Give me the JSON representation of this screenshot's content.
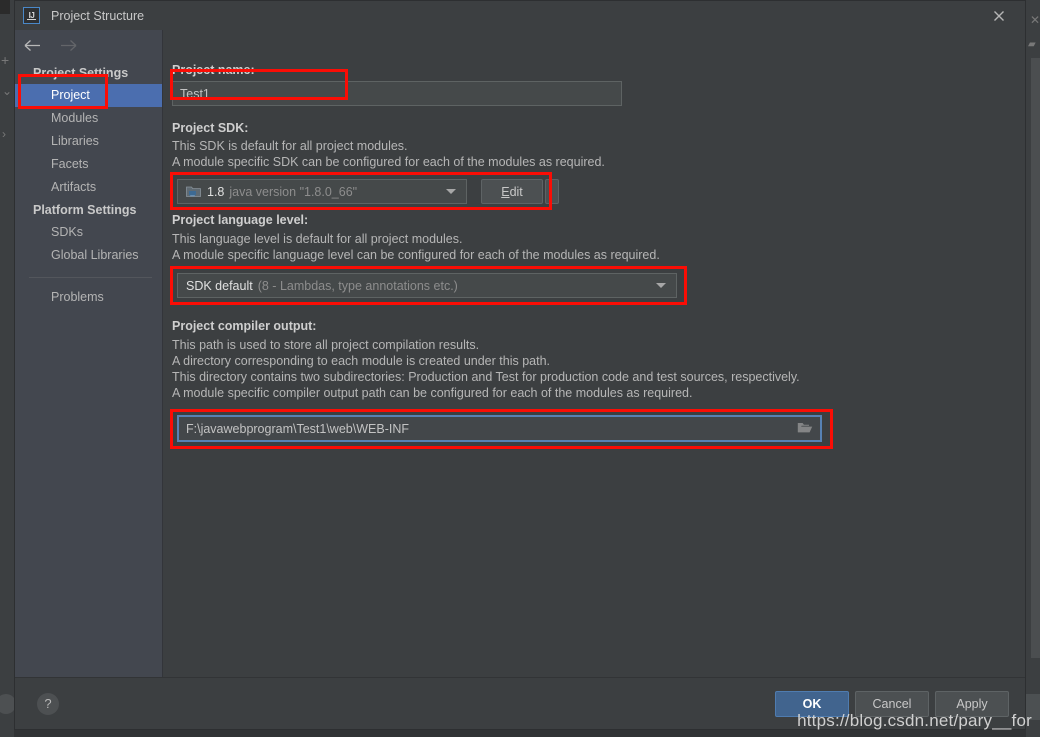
{
  "window": {
    "title": "Project Structure",
    "logo_text": "IJ",
    "close_icon": "close-icon"
  },
  "nav": {
    "back_icon": "arrow-left-icon",
    "forward_icon": "arrow-right-icon"
  },
  "sidebar": {
    "groups": [
      {
        "label": "Project Settings",
        "items": [
          {
            "label": "Project",
            "selected": true
          },
          {
            "label": "Modules",
            "selected": false
          },
          {
            "label": "Libraries",
            "selected": false
          },
          {
            "label": "Facets",
            "selected": false
          },
          {
            "label": "Artifacts",
            "selected": false
          }
        ]
      },
      {
        "label": "Platform Settings",
        "items": [
          {
            "label": "SDKs",
            "selected": false
          },
          {
            "label": "Global Libraries",
            "selected": false
          }
        ]
      }
    ],
    "extra_item": "Problems"
  },
  "main": {
    "project_name": {
      "title": "Project name:",
      "value": "Test1",
      "placeholder": ""
    },
    "project_sdk": {
      "title": "Project SDK:",
      "desc_line1": "This SDK is default for all project modules.",
      "desc_line2": "A module specific SDK can be configured for each of the modules as required.",
      "value_main": "1.8",
      "value_dim": "java version \"1.8.0_66\"",
      "icon": "sdk-folder-icon",
      "edit_button": "Edit",
      "edit_mnemonic": "E",
      "edit_rest": "dit"
    },
    "language_level": {
      "title": "Project language level:",
      "desc_line1": "This language level is default for all project modules.",
      "desc_line2": "A module specific language level can be configured for each of the modules as required.",
      "value_main": "SDK default",
      "value_dim": "(8 - Lambdas, type annotations etc.)"
    },
    "compiler_output": {
      "title": "Project compiler output:",
      "desc_line1": "This path is used to store all project compilation results.",
      "desc_line2": "A directory corresponding to each module is created under this path.",
      "desc_line3": "This directory contains two subdirectories: Production and Test for production code and test sources, respectively.",
      "desc_line4": "A module specific compiler output path can be configured for each of the modules as required.",
      "value": "F:\\javawebprogram\\Test1\\web\\WEB-INF",
      "browse_icon": "folder-browse-icon"
    }
  },
  "footer": {
    "help_label": "?",
    "ok_label": "OK",
    "cancel_label": "Cancel",
    "apply_label": "Apply"
  },
  "watermark": {
    "text": "https://blog.csdn.net/pary__for"
  },
  "colors": {
    "dialog_bg": "#3c3f41",
    "sidebar_bg": "#43474f",
    "selection_blue": "#4b6eaf",
    "annotation_red": "#fb0d05",
    "primary_button": "#41648e",
    "focus_border": "#5781b4"
  }
}
